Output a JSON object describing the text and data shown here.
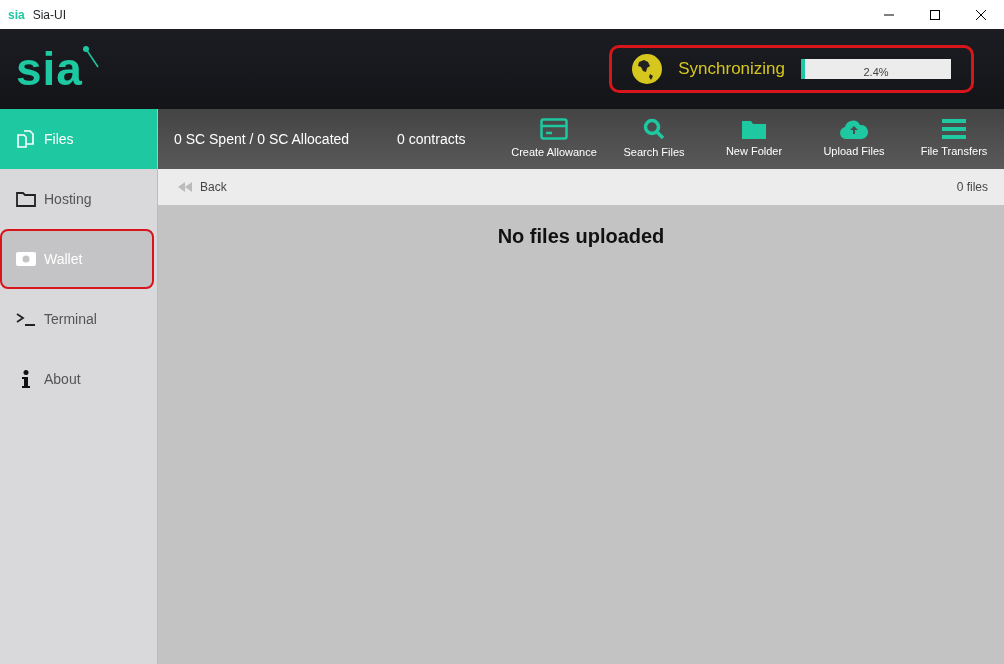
{
  "window": {
    "logo": "sia",
    "title": "Sia-UI"
  },
  "header": {
    "logo": "sia",
    "sync": {
      "label": "Synchronizing",
      "level": 0.024,
      "reading": "2.4%",
      "highlighted": true
    }
  },
  "sidebar": {
    "items": [
      {
        "kind": "files",
        "label": "Files",
        "selected": true,
        "hovered": false,
        "highlighted": false
      },
      {
        "kind": "hosting",
        "label": "Hosting",
        "selected": false,
        "hovered": false,
        "highlighted": false
      },
      {
        "kind": "wallet",
        "label": "Wallet",
        "selected": false,
        "hovered": true,
        "highlighted": true
      },
      {
        "kind": "terminal",
        "label": "Terminal",
        "selected": false,
        "hovered": false,
        "highlighted": false
      },
      {
        "kind": "about",
        "label": "About",
        "selected": false,
        "hovered": false,
        "highlighted": false
      }
    ]
  },
  "toolbar": {
    "spent": "0 SC Spent / 0 SC Allocated",
    "contracts": "0 contracts",
    "buttons": [
      {
        "kind": "allowance",
        "label": "Create Allowance"
      },
      {
        "kind": "search",
        "label": "Search Files"
      },
      {
        "kind": "folder",
        "label": "New Folder"
      },
      {
        "kind": "upload",
        "label": "Upload Files"
      },
      {
        "kind": "transfers",
        "label": "File Transfers"
      }
    ]
  },
  "breadcrumb": {
    "back": "Back",
    "count": "0 files"
  },
  "content": {
    "message": "No files uploaded"
  }
}
